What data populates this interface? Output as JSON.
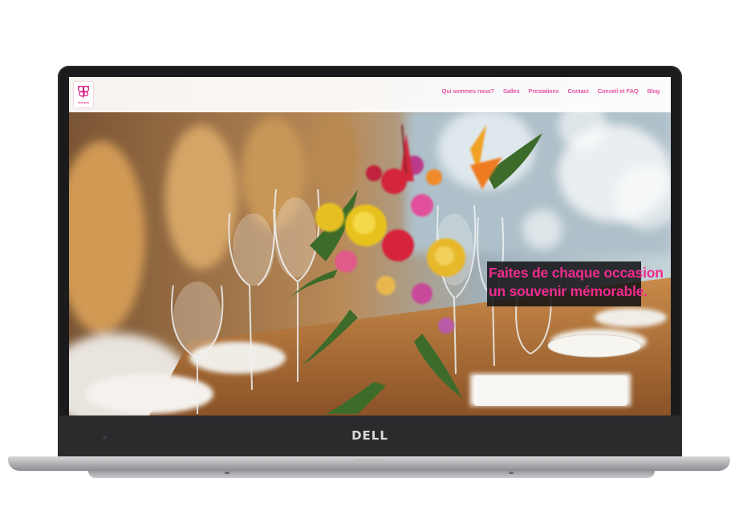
{
  "device": {
    "brand": "DELL"
  },
  "site": {
    "logo_text": "AFRAIGN",
    "nav": [
      {
        "label": "Qui sommes nous?"
      },
      {
        "label": "Salles"
      },
      {
        "label": "Prestations"
      },
      {
        "label": "Contact"
      },
      {
        "label": "Conseil et FAQ"
      },
      {
        "label": "Blog"
      }
    ]
  },
  "hero": {
    "tagline_line1": "Faites de chaque occasion",
    "tagline_line2": "un souvenir mémorable."
  },
  "colors": {
    "accent": "#e0167f",
    "tagline_text": "#ef2b8e",
    "tagline_bg": "#121014",
    "bezel": "#1b1b1d"
  }
}
